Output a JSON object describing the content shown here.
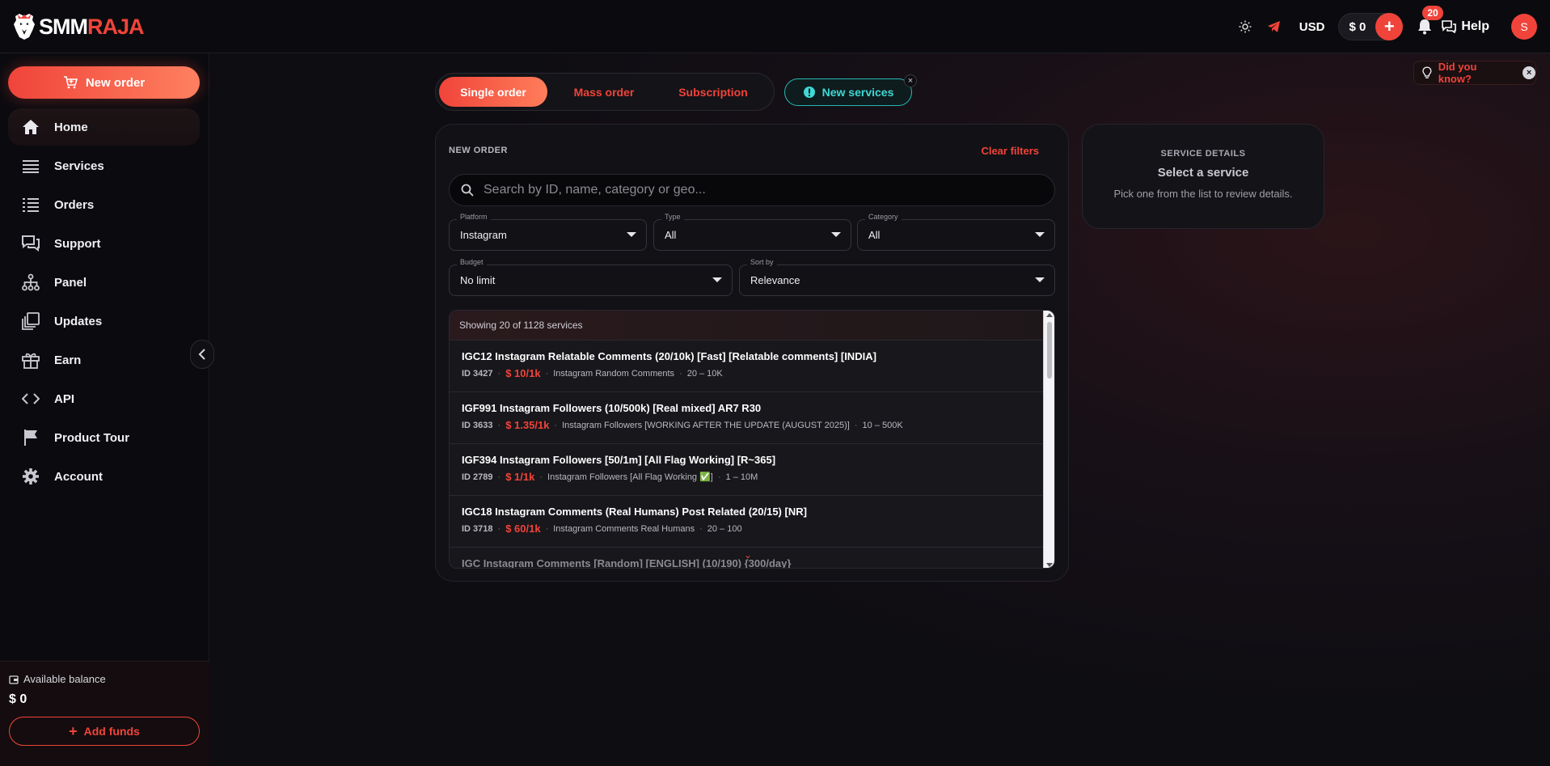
{
  "brand": {
    "logo_white": "SMM",
    "logo_red": "RAJA",
    "accent": "#f0443a",
    "teal": "#26b7b4"
  },
  "header": {
    "currency": "USD",
    "balance": "$ 0",
    "add_icon": "plus-icon",
    "notifications_count": "20",
    "help_label": "Help",
    "avatar_letter": "S"
  },
  "sidebar": {
    "new_order_label": "New order",
    "items": [
      {
        "label": "Home",
        "icon": "home-icon",
        "active": true
      },
      {
        "label": "Services",
        "icon": "services-icon"
      },
      {
        "label": "Orders",
        "icon": "orders-icon"
      },
      {
        "label": "Support",
        "icon": "support-icon"
      },
      {
        "label": "Panel",
        "icon": "panel-icon"
      },
      {
        "label": "Updates",
        "icon": "updates-icon"
      },
      {
        "label": "Earn",
        "icon": "gift-icon"
      },
      {
        "label": "API",
        "icon": "code-icon"
      },
      {
        "label": "Product Tour",
        "icon": "flag-icon"
      },
      {
        "label": "Account",
        "icon": "gear-icon"
      }
    ],
    "balance_label": "Available balance",
    "balance_value": "$ 0",
    "add_funds_label": "Add funds"
  },
  "tabs": {
    "single": "Single order",
    "mass": "Mass order",
    "subscription": "Subscription",
    "new_services": "New services"
  },
  "did_you_know": "Did you know?",
  "order": {
    "title": "NEW ORDER",
    "clear_filters": "Clear filters",
    "search_placeholder": "Search by ID, name, category or geo...",
    "filters": {
      "platform": {
        "label": "Platform",
        "value": "Instagram"
      },
      "type": {
        "label": "Type",
        "value": "All"
      },
      "category": {
        "label": "Category",
        "value": "All"
      },
      "budget": {
        "label": "Budget",
        "value": "No limit"
      },
      "sort": {
        "label": "Sort by",
        "value": "Relevance"
      }
    },
    "showing": "Showing 20 of 1128 services",
    "services": [
      {
        "name": "IGC12 Instagram Relatable Comments (20/10k) [Fast] [Relatable comments] [INDIA]",
        "id": "ID 3427",
        "price": "$ 10/1k",
        "category": "Instagram Random Comments",
        "range": "20 – 10K"
      },
      {
        "name": "IGF991 Instagram Followers (10/500k) [Real mixed] AR7 R30",
        "id": "ID 3633",
        "price": "$ 1.35/1k",
        "category": "Instagram Followers [WORKING AFTER THE UPDATE (AUGUST 2025)]",
        "range": "10 – 500K"
      },
      {
        "name": "IGF394 Instagram Followers [50/1m] [All Flag Working] [R~365]",
        "id": "ID 2789",
        "price": "$ 1/1k",
        "category": "Instagram Followers [All Flag Working ✅]",
        "range": "1 – 10M"
      },
      {
        "name": "IGC18 Instagram Comments (Real Humans) Post Related (20/15) [NR]",
        "id": "ID 3718",
        "price": "$ 60/1k",
        "category": "Instagram Comments Real Humans",
        "range": "20 – 100"
      },
      {
        "name": "IGC Instagram Comments [Random] [ENGLISH] (10/190) {300/day}",
        "id": "",
        "price": "",
        "category": "",
        "range": ""
      }
    ]
  },
  "details": {
    "title": "SERVICE DETAILS",
    "subtitle": "Select a service",
    "hint": "Pick one from the list to review details."
  }
}
